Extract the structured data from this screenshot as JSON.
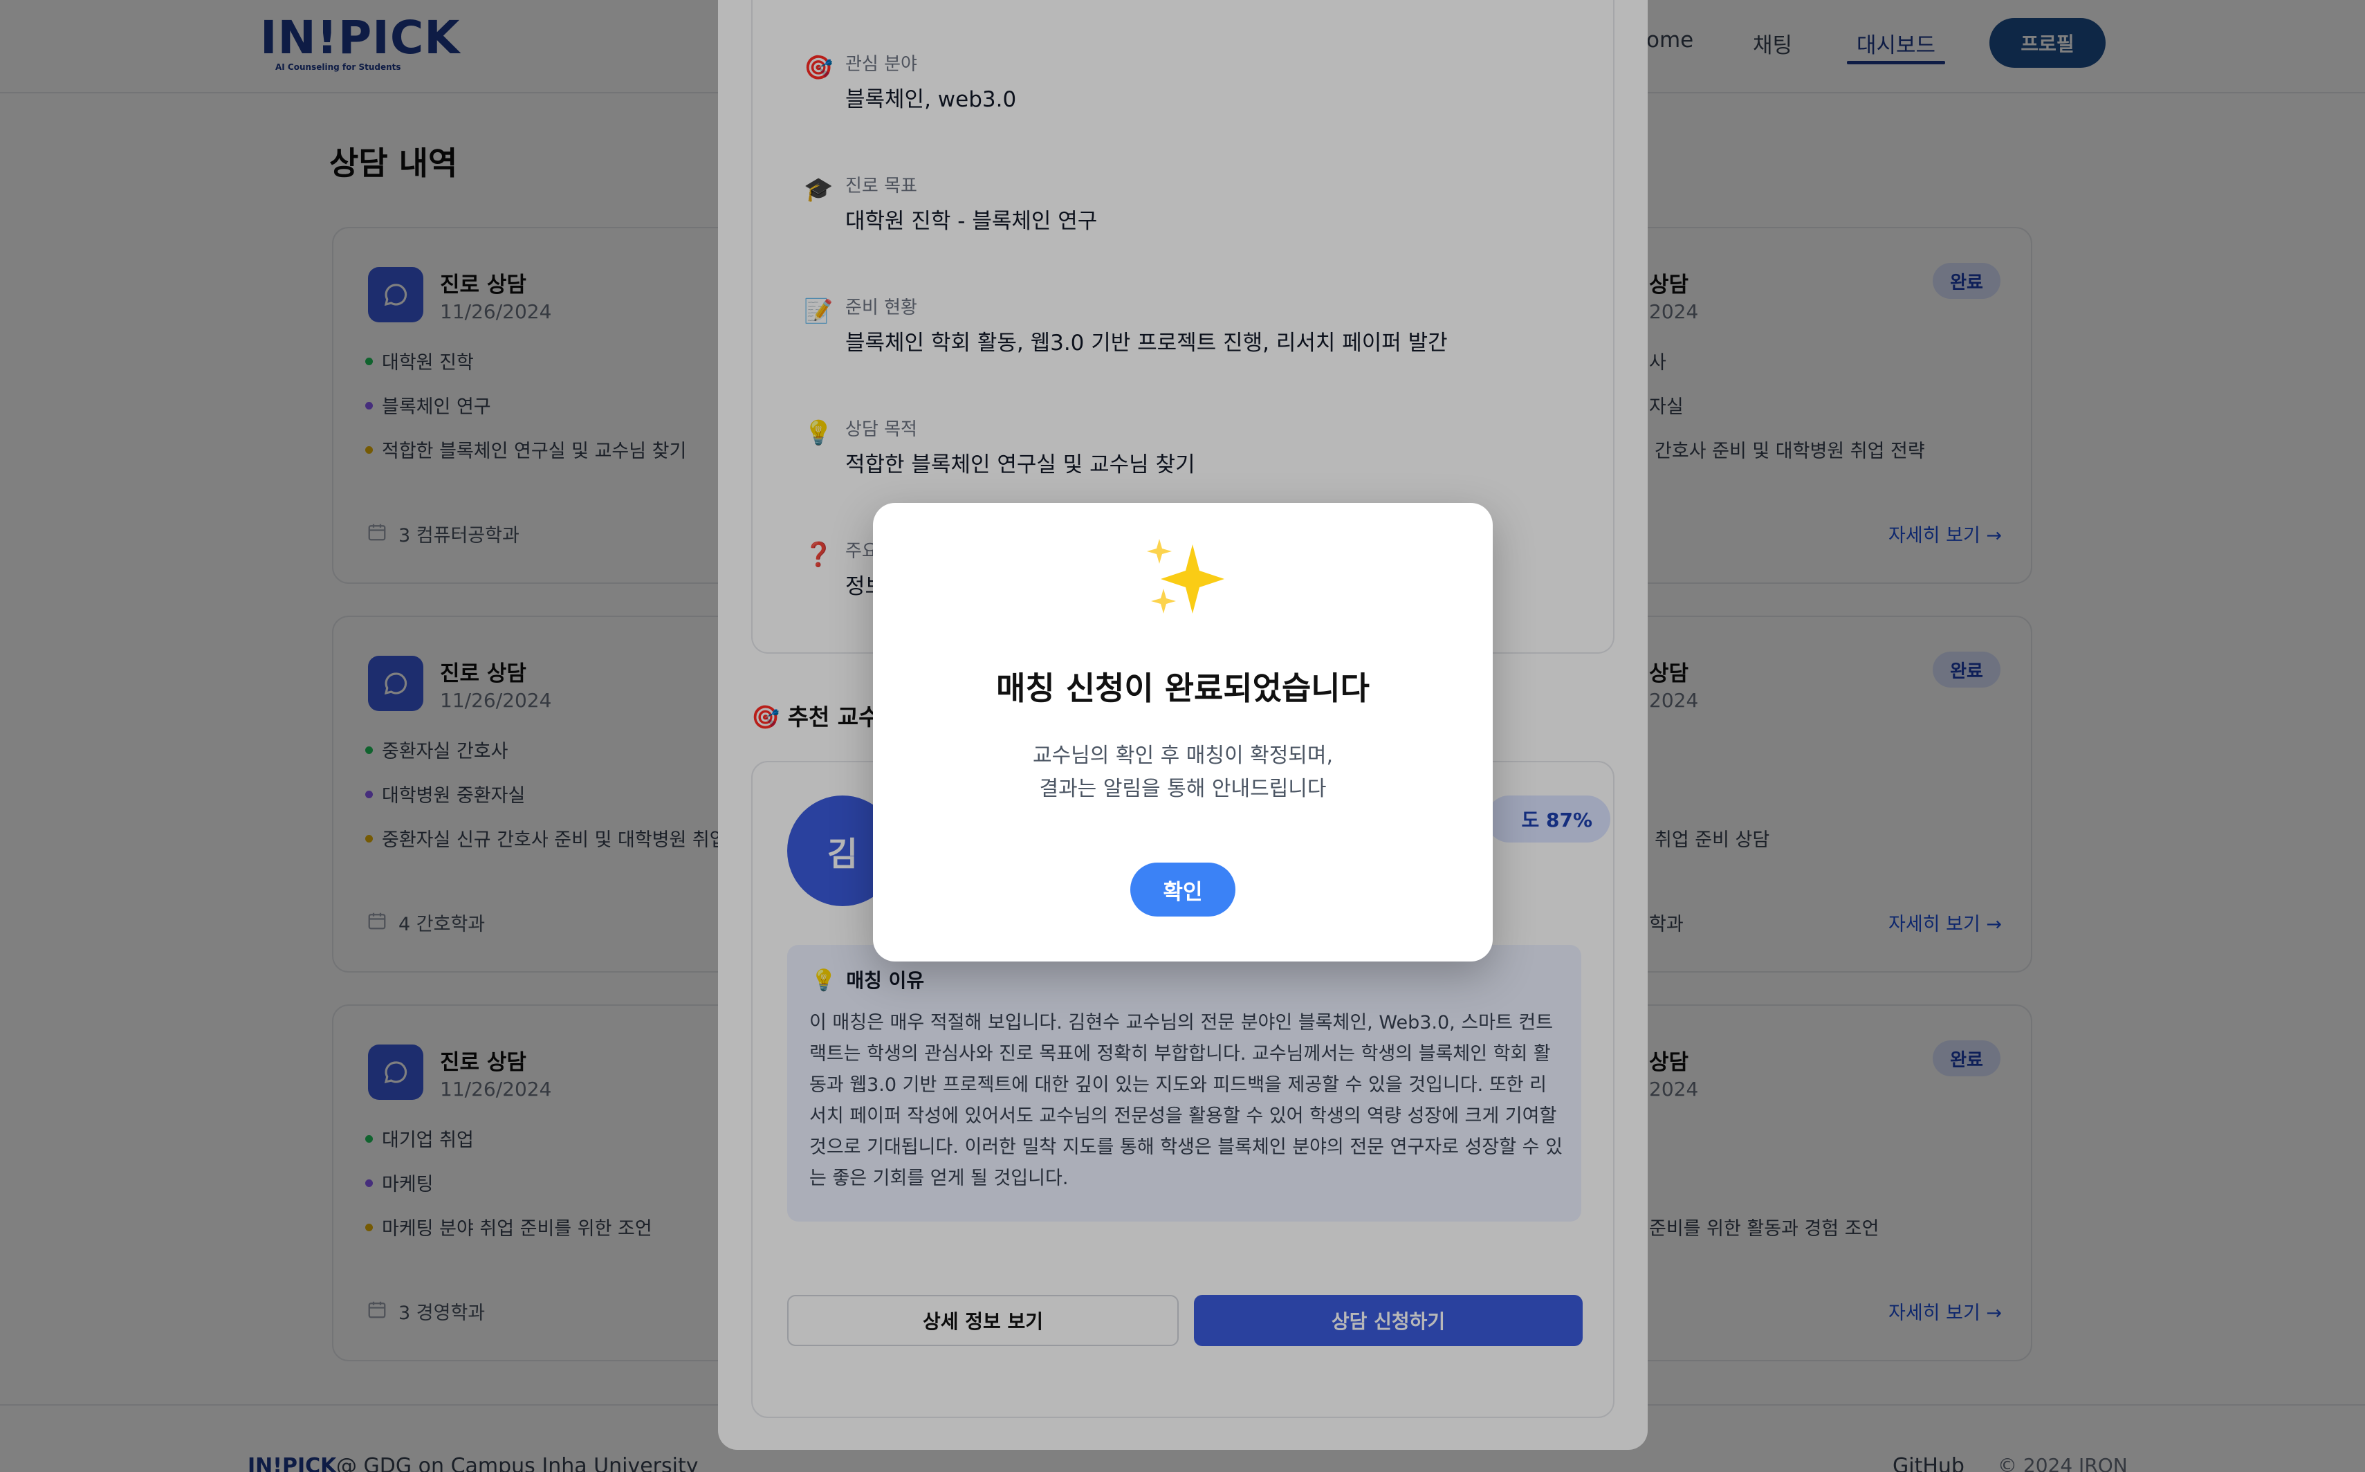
{
  "nav": {
    "logo": "IN!PICK",
    "logo_sub": "AI Counseling for Students",
    "home": "ome",
    "chat": "채팅",
    "dashboard": "대시보드",
    "profile": "프로필"
  },
  "page_title": "상담 내역",
  "cards_left": [
    {
      "title": "진로 상담",
      "date": "11/26/2024",
      "items": [
        "대학원 진학",
        "블록체인 연구",
        "적합한 블록체인 연구실 및 교수님 찾기"
      ],
      "footer": "3 컴퓨터공학과"
    },
    {
      "title": "진로 상담",
      "date": "11/26/2024",
      "items": [
        "중환자실 간호사",
        "대학병원 중환자실",
        "중환자실 신규 간호사 준비 및 대학병원 취업"
      ],
      "footer": "4 간호학과"
    },
    {
      "title": "진로 상담",
      "date": "11/26/2024",
      "items": [
        "대기업 취업",
        "마케팅",
        "마케팅 분야 취업 준비를 위한 조언"
      ],
      "footer": "3 경영학과"
    }
  ],
  "cards_right": [
    {
      "title": "상담",
      "date": "2024",
      "items": [
        "사",
        "자실",
        "간호사 준비 및 대학병원 취업 전략"
      ],
      "badge": "완료",
      "link": "자세히 보기 →"
    },
    {
      "title": "상담",
      "date": "2024",
      "items": [
        "취업 준비 상담"
      ],
      "footer": "학과",
      "badge": "완료",
      "link": "자세히 보기 →"
    },
    {
      "title": "상담",
      "date": "2024",
      "items": [
        "준비를 위한 활동과 경험 조언"
      ],
      "badge": "완료",
      "link": "자세히 보기 →"
    }
  ],
  "panel": {
    "info": [
      {
        "emoji": "🎯",
        "label": "관심 분야",
        "value": "블록체인, web3.0"
      },
      {
        "emoji": "🎓",
        "label": "진로 목표",
        "value": "대학원 진학 - 블록체인 연구"
      },
      {
        "emoji": "📝",
        "label": "준비 현황",
        "value": "블록체인 학회 활동, 웹3.0 기반 프로젝트 진행, 리서치 페이퍼 발간"
      },
      {
        "emoji": "💡",
        "label": "상담 목적",
        "value": "적합한 블록체인 연구실 및 교수님 찾기"
      },
      {
        "emoji": "❓",
        "label": "주요",
        "value": "정보"
      }
    ],
    "rec_title": "🎯 추천 교수",
    "avatar": "김",
    "match": "도 87%",
    "reason_title": "매칭 이유",
    "reason_body": "이 매칭은 매우 적절해 보입니다. 김현수 교수님의 전문 분야인 블록체인, Web3.0, 스마트 컨트랙트는 학생의 관심사와 진로 목표에 정확히 부합합니다. 교수님께서는 학생의 블록체인 학회 활동과 웹3.0 기반 프로젝트에 대한 깊이 있는 지도와 피드백을 제공할 수 있을 것입니다. 또한 리서치 페이퍼 작성에 있어서도 교수님의 전문성을 활용할 수 있어 학생의 역량 성장에 크게 기여할 것으로 기대됩니다. 이러한 밀착 지도를 통해 학생은 블록체인 분야의 전문 연구자로 성장할 수 있는 좋은 기회를 얻게 될 것입니다.",
    "btn_detail": "상세 정보 보기",
    "btn_apply": "상담 신청하기"
  },
  "modal": {
    "icon": "sparkles-icon",
    "title": "매칭 신청이 완료되었습니다",
    "line1": "교수님의 확인 후 매칭이 확정되며,",
    "line2": "결과는 알림을 통해 안내드립니다",
    "confirm": "확인"
  },
  "footer": {
    "brand": "IN!PICK",
    "org": "@ GDG on Campus Inha University",
    "github": "GitHub",
    "copyright": "© 2024 IRON"
  },
  "colors": {
    "primary": "#3b5bdb",
    "navy": "#1e3a8a",
    "modal_button": "#3b82f6",
    "dot_green": "#22c55e",
    "dot_purple": "#8b5cf6",
    "dot_yellow": "#eab308"
  }
}
